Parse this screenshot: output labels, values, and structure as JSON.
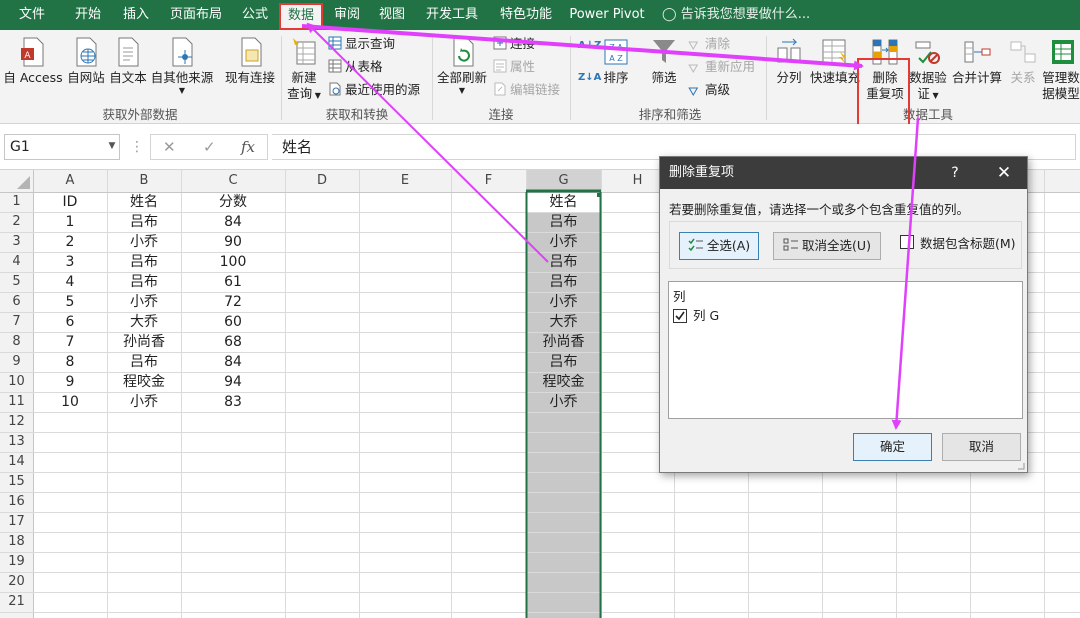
{
  "tabs": [
    {
      "label": "文件",
      "active": false
    },
    {
      "label": "开始",
      "active": false
    },
    {
      "label": "插入",
      "active": false
    },
    {
      "label": "页面布局",
      "active": false
    },
    {
      "label": "公式",
      "active": false
    },
    {
      "label": "数据",
      "active": true
    },
    {
      "label": "审阅",
      "active": false
    },
    {
      "label": "视图",
      "active": false
    },
    {
      "label": "开发工具",
      "active": false
    },
    {
      "label": "特色功能",
      "active": false
    },
    {
      "label": "Power Pivot",
      "active": false
    }
  ],
  "tell_me": "告诉我您想要做什么...",
  "ribbon": {
    "get_external": {
      "from_access": "自 Access",
      "from_web": "自网站",
      "from_text": "自文本",
      "from_other": "自其他来源",
      "existing": "现有连接",
      "group_label": "获取外部数据"
    },
    "get_transform": {
      "new_query_1": "新建",
      "new_query_2": "查询",
      "show_queries": "显示查询",
      "from_table": "从表格",
      "recent_sources": "最近使用的源",
      "group_label": "获取和转换"
    },
    "connections": {
      "refresh_all": "全部刷新",
      "connections": "连接",
      "properties": "属性",
      "edit_links": "编辑链接",
      "group_label": "连接"
    },
    "sort_filter": {
      "sort": "排序",
      "filter": "筛选",
      "clear": "清除",
      "reapply": "重新应用",
      "advanced": "高级",
      "group_label": "排序和筛选"
    },
    "data_tools": {
      "text_to_columns": "分列",
      "flash_fill": "快速填充",
      "remove_dup_1": "删除",
      "remove_dup_2": "重复项",
      "validation_1": "数据验",
      "validation_2": "证",
      "consolidate": "合并计算",
      "relationships": "关系",
      "manage_model_1": "管理数",
      "manage_model_2": "据模型",
      "group_label": "数据工具"
    }
  },
  "formula_bar": {
    "name_box": "G1",
    "fx": "fx",
    "cancel": "✕",
    "enter": "✓",
    "dots": "⋮",
    "content": "姓名"
  },
  "sheet": {
    "columns": [
      "A",
      "B",
      "C",
      "D",
      "E",
      "F",
      "G",
      "H"
    ],
    "last_column_partial": "I",
    "rows": [
      "1",
      "2",
      "3",
      "4",
      "5",
      "6",
      "7",
      "8",
      "9",
      "10",
      "11",
      "12",
      "13",
      "14",
      "15",
      "16",
      "17",
      "18",
      "19",
      "20",
      "21"
    ],
    "table": {
      "headers": [
        "ID",
        "姓名",
        "分数"
      ],
      "data": [
        [
          "1",
          "吕布",
          "84"
        ],
        [
          "2",
          "小乔",
          "90"
        ],
        [
          "3",
          "吕布",
          "100"
        ],
        [
          "4",
          "吕布",
          "61"
        ],
        [
          "5",
          "小乔",
          "72"
        ],
        [
          "6",
          "大乔",
          "60"
        ],
        [
          "7",
          "孙尚香",
          "68"
        ],
        [
          "8",
          "吕布",
          "84"
        ],
        [
          "9",
          "程咬金",
          "94"
        ],
        [
          "10",
          "小乔",
          "83"
        ]
      ]
    },
    "col_g": [
      "姓名",
      "吕布",
      "小乔",
      "吕布",
      "吕布",
      "小乔",
      "大乔",
      "孙尚香",
      "吕布",
      "程咬金",
      "小乔"
    ]
  },
  "dialog": {
    "title": "删除重复项",
    "help": "?",
    "close": "✕",
    "instruction": "若要删除重复值，请选择一个或多个包含重复值的列。",
    "select_all": "全选(A)",
    "unselect_all": "取消全选(U)",
    "has_headers": "数据包含标题(M)",
    "has_headers_checked": false,
    "list_header": "列",
    "column_item": "列 G",
    "column_item_checked": true,
    "ok": "确定",
    "cancel": "取消"
  },
  "colors": {
    "excel_green": "#217346",
    "highlight_red": "#e53935",
    "arrow_magenta": "#e040fb",
    "selection_gray": "#c8c8c8",
    "dialog_titlebar": "#3c3c3c"
  }
}
